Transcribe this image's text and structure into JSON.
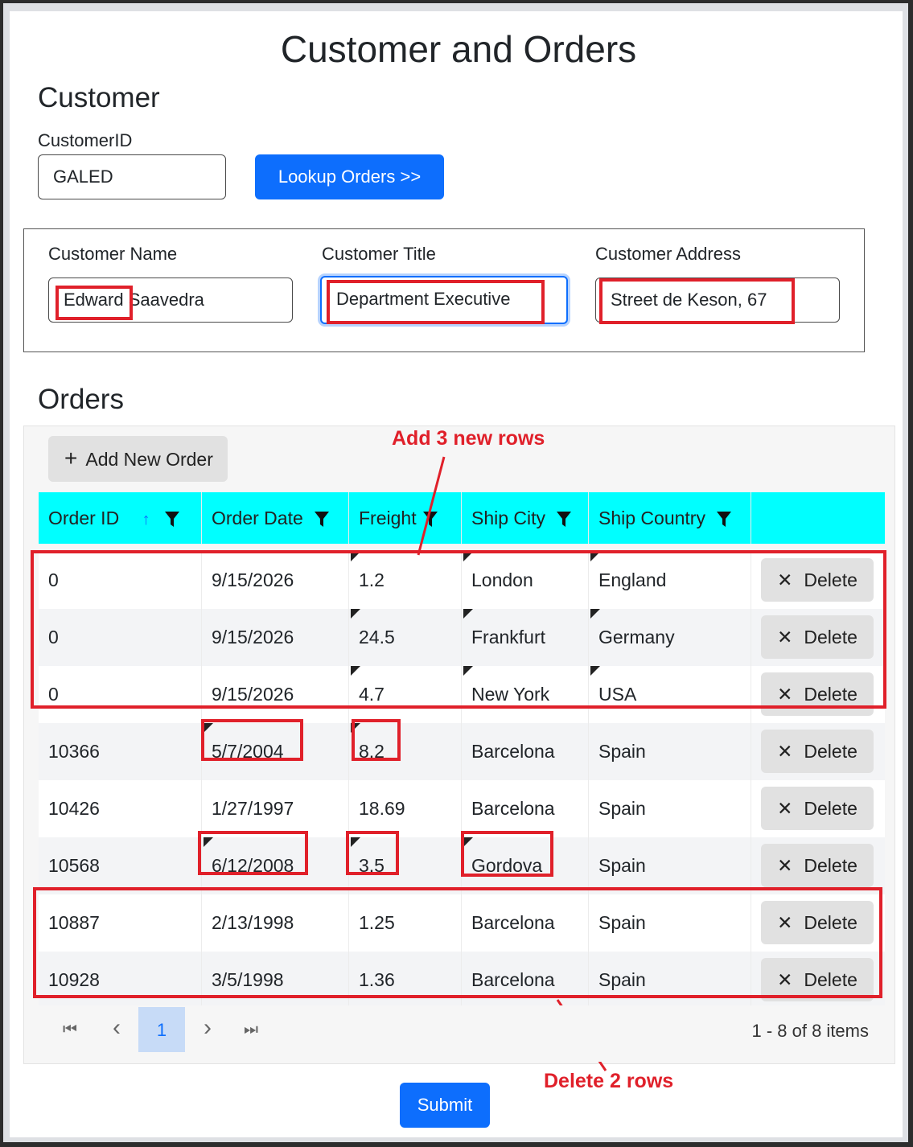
{
  "page": {
    "title": "Customer and Orders"
  },
  "customer_section": {
    "heading": "Customer",
    "customer_id_label": "CustomerID",
    "customer_id_value": "GALED",
    "lookup_button": "Lookup Orders >>"
  },
  "customer_details": {
    "name_label": "Customer Name",
    "name_value": "Edward Saavedra",
    "title_label": "Customer Title",
    "title_value": "Department Executive",
    "address_label": "Customer Address",
    "address_value": "Street de Keson, 67"
  },
  "orders": {
    "heading": "Orders",
    "add_button": "Add New Order",
    "add_icon": "+",
    "columns": [
      "Order ID",
      "Order Date",
      "Freight",
      "Ship City",
      "Ship Country"
    ],
    "sort_icon": "↑",
    "delete_icon": "✕",
    "delete_label": "Delete",
    "rows": [
      {
        "id": "0",
        "date": "9/15/2026",
        "freight": "1.2",
        "city": "London",
        "country": "England"
      },
      {
        "id": "0",
        "date": "9/15/2026",
        "freight": "24.5",
        "city": "Frankfurt",
        "country": "Germany"
      },
      {
        "id": "0",
        "date": "9/15/2026",
        "freight": "4.7",
        "city": "New York",
        "country": "USA"
      },
      {
        "id": "10366",
        "date": "5/7/2004",
        "freight": "8.2",
        "city": "Barcelona",
        "country": "Spain"
      },
      {
        "id": "10426",
        "date": "1/27/1997",
        "freight": "18.69",
        "city": "Barcelona",
        "country": "Spain"
      },
      {
        "id": "10568",
        "date": "6/12/2008",
        "freight": "3.5",
        "city": "Gordova",
        "country": "Spain"
      },
      {
        "id": "10887",
        "date": "2/13/1998",
        "freight": "1.25",
        "city": "Barcelona",
        "country": "Spain"
      },
      {
        "id": "10928",
        "date": "3/5/1998",
        "freight": "1.36",
        "city": "Barcelona",
        "country": "Spain"
      }
    ]
  },
  "pager": {
    "first_icon": "⏮",
    "prev_icon": "‹",
    "current_page": "1",
    "next_icon": "›",
    "last_icon": "⏭",
    "summary": "1 - 8 of 8 items"
  },
  "annotations": {
    "add_rows": "Add 3 new rows",
    "delete_rows": "Delete 2 rows"
  },
  "submit_button": "Submit",
  "colors": {
    "primary": "#0d6efd",
    "header_bg": "#00ffff",
    "annotation_red": "#e0202a"
  }
}
